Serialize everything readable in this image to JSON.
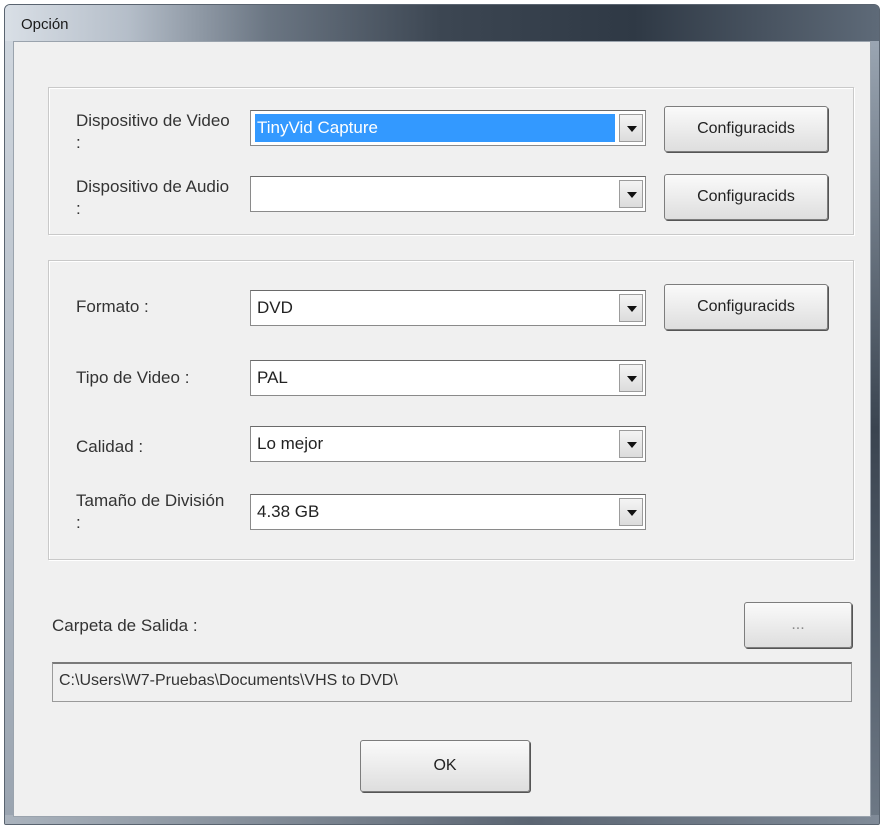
{
  "window": {
    "title": "Opción"
  },
  "devices": {
    "video_label": "Dispositivo de Video :",
    "video_value": "TinyVid Capture",
    "video_config": "Configuracids",
    "audio_label": "Dispositivo de Audio :",
    "audio_value": "",
    "audio_config": "Configuracids"
  },
  "format": {
    "format_label": "Formato :",
    "format_value": "DVD",
    "format_config": "Configuracids",
    "video_type_label": "Tipo de Video :",
    "video_type_value": "PAL",
    "quality_label": "Calidad :",
    "quality_value": "Lo mejor",
    "split_label": "Tamaño de División :",
    "split_value": "4.38 GB"
  },
  "output": {
    "folder_label": "Carpeta de Salida :",
    "browse_label": "...",
    "path": "C:\\Users\\W7-Pruebas\\Documents\\VHS to DVD\\"
  },
  "footer": {
    "ok_label": "OK"
  },
  "icons": {
    "dropdown": "chevron-down-icon"
  },
  "colors": {
    "selection": "#3399ff",
    "dialog_bg": "#f0f0f0"
  }
}
